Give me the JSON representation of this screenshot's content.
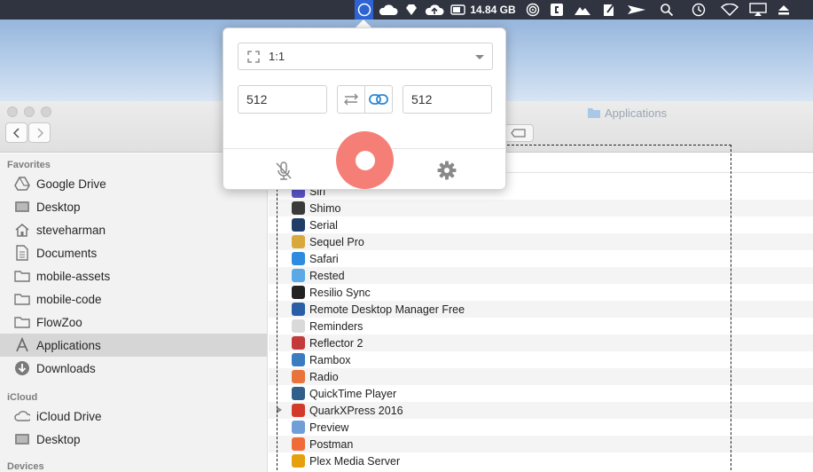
{
  "menubar": {
    "storage_label": "14.84 GB",
    "icons": [
      "recorder-icon",
      "cloud-icon",
      "diamond-icon",
      "cloud-upload-icon",
      "battery-icon",
      "target-icon",
      "app-c-icon",
      "mountain-icon",
      "edit-icon",
      "send-icon",
      "search-icon",
      "time-machine-icon",
      "wifi-icon",
      "airplay-icon",
      "eject-icon"
    ]
  },
  "recorder": {
    "ratio_value": "1:1",
    "width_value": "512",
    "height_value": "512",
    "record_color": "#f57f76",
    "link_color": "#2a86d6"
  },
  "finder": {
    "window_title": "Applications",
    "sidebar": {
      "favorites_title": "Favorites",
      "favorites": [
        {
          "label": "Google Drive",
          "icon": "google-drive-icon"
        },
        {
          "label": "Desktop",
          "icon": "desktop-icon"
        },
        {
          "label": "steveharman",
          "icon": "home-icon"
        },
        {
          "label": "Documents",
          "icon": "documents-icon"
        },
        {
          "label": "mobile-assets",
          "icon": "folder-icon"
        },
        {
          "label": "mobile-code",
          "icon": "folder-icon"
        },
        {
          "label": "FlowZoo",
          "icon": "folder-icon"
        },
        {
          "label": "Applications",
          "icon": "applications-icon"
        },
        {
          "label": "Downloads",
          "icon": "downloads-icon"
        }
      ],
      "icloud_title": "iCloud",
      "icloud": [
        {
          "label": "iCloud Drive",
          "icon": "icloud-icon"
        },
        {
          "label": "Desktop",
          "icon": "desktop-icon"
        }
      ],
      "devices_title": "Devices",
      "selected": "Applications"
    },
    "files": [
      {
        "name": "Siri",
        "color": "#5a55c9"
      },
      {
        "name": "Shimo",
        "color": "#3a3a3a"
      },
      {
        "name": "Serial",
        "color": "#1f3d66"
      },
      {
        "name": "Sequel Pro",
        "color": "#d8a93a"
      },
      {
        "name": "Safari",
        "color": "#2d8be0"
      },
      {
        "name": "Rested",
        "color": "#5aa9e6"
      },
      {
        "name": "Resilio Sync",
        "color": "#222222"
      },
      {
        "name": "Remote Desktop Manager Free",
        "color": "#2a5fa8"
      },
      {
        "name": "Reminders",
        "color": "#d9d9d9"
      },
      {
        "name": "Reflector 2",
        "color": "#c23a3a"
      },
      {
        "name": "Rambox",
        "color": "#3b7bbf"
      },
      {
        "name": "Radio",
        "color": "#e8743b"
      },
      {
        "name": "QuickTime Player",
        "color": "#2f5f8a"
      },
      {
        "name": "QuarkXPress 2016",
        "color": "#d23b2a"
      },
      {
        "name": "Preview",
        "color": "#6f9fd6"
      },
      {
        "name": "Postman",
        "color": "#ef6b3a"
      },
      {
        "name": "Plex Media Server",
        "color": "#e5a00d"
      }
    ]
  }
}
